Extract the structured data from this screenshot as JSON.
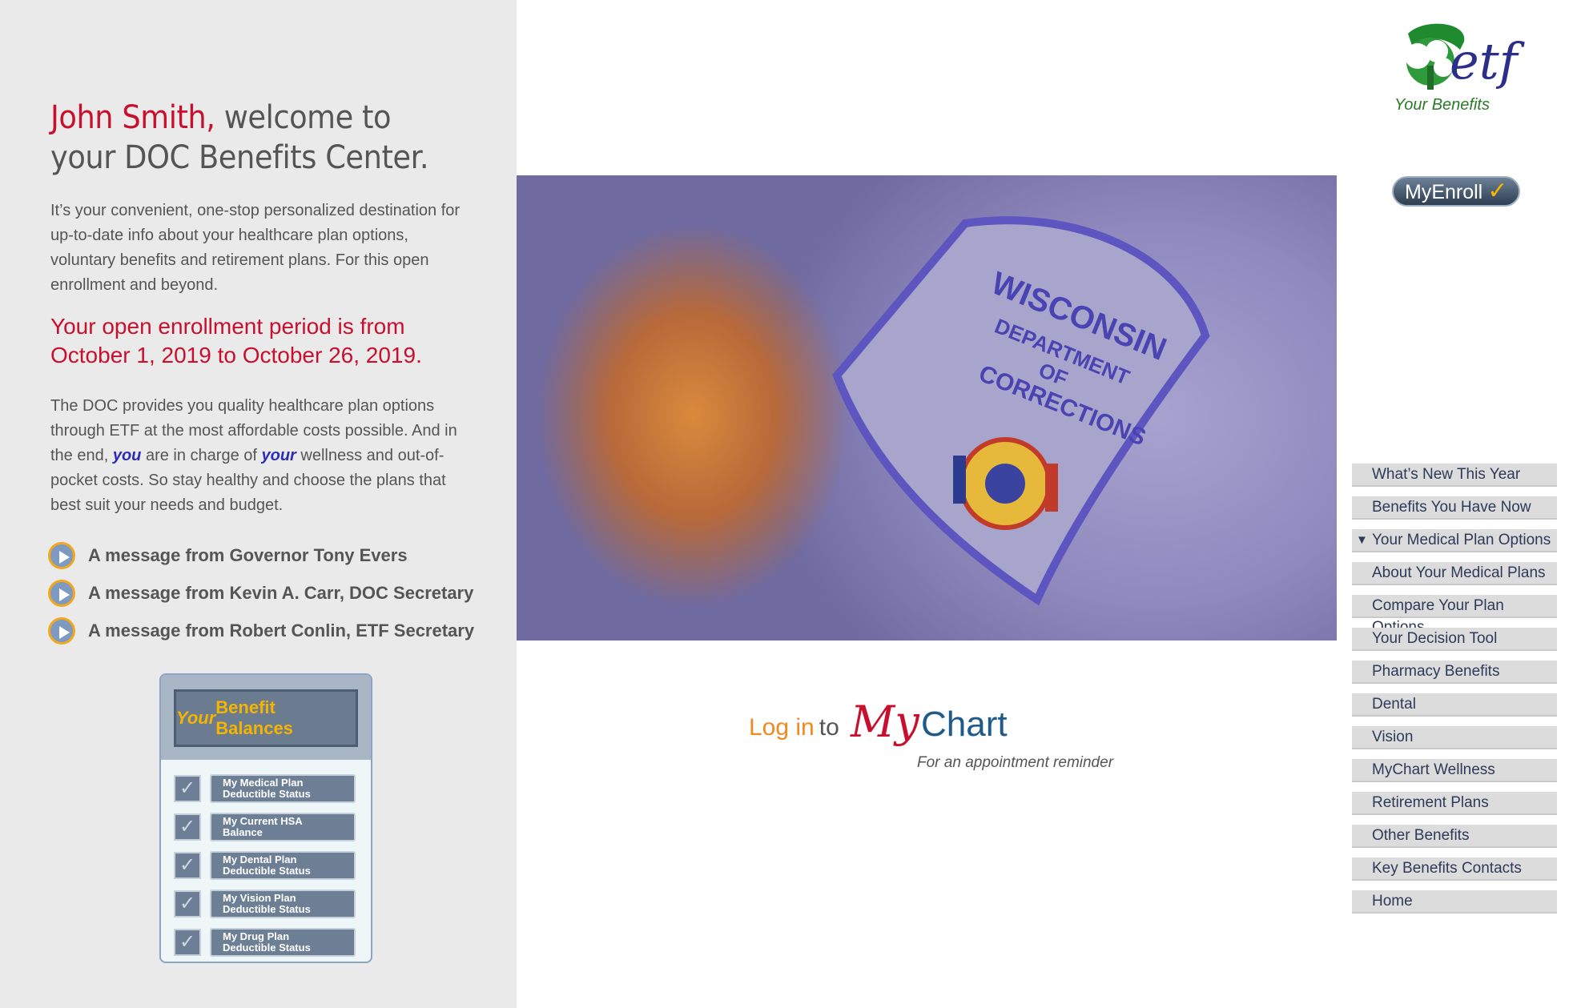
{
  "welcome": {
    "name": "John Smith,",
    "rest": " welcome to your DOC Benefits Center."
  },
  "intro": "It’s your convenient, one-stop personalized destination for up-to-date info about your healthcare plan options, voluntary benefits and retirement plans. For this open enrollment and beyond.",
  "enrollment_period": "Your open enrollment period is from October 1, 2019 to October 26, 2019.",
  "body": {
    "part1": "The DOC provides you quality healthcare plan options through ETF at the most affordable costs possible. And in the end, ",
    "you": "you",
    "part2": " are in charge of ",
    "your": "your",
    "part3": " wellness and out-of-pocket costs. So stay healthy and choose the plans that best suit your needs and budget."
  },
  "messages": [
    "A message from Governor Tony Evers",
    "A message from Kevin A. Carr, DOC Secretary",
    "A message from Robert Conlin, ETF Secretary"
  ],
  "balances": {
    "title_your": "Your",
    "title_rest": " Benefit Balances",
    "items": [
      "My Medical Plan\nDeductible Status",
      "My Current HSA\nBalance",
      "My Dental Plan\nDeductible Status",
      "My Vision Plan\nDeductible Status",
      "My Drug Plan\nDeductible Status"
    ]
  },
  "badge": {
    "line1": "WISCONSIN",
    "line2": "DEPARTMENT",
    "line3": "OF",
    "line4": "CORRECTIONS"
  },
  "mychart": {
    "login": "Log in",
    "to": "to",
    "my": "My",
    "chart": "Chart",
    "reminder": "For an appointment reminder"
  },
  "logo": {
    "etf": "etf",
    "tagline": "Your Benefits"
  },
  "myenroll": {
    "label": "MyEnroll",
    "check": "✓"
  },
  "nav": [
    {
      "label": "What’s New This Year",
      "active": false
    },
    {
      "label": "Benefits You Have Now",
      "active": false
    },
    {
      "label": "Your Medical Plan Options",
      "active": true
    },
    {
      "label": "About Your Medical Plans",
      "active": false
    },
    {
      "label": "Compare Your Plan Options",
      "active": false
    },
    {
      "label": "Your Decision Tool",
      "active": false
    },
    {
      "label": "Pharmacy Benefits",
      "active": false
    },
    {
      "label": "Dental",
      "active": false
    },
    {
      "label": "Vision",
      "active": false
    },
    {
      "label": "MyChart Wellness",
      "active": false
    },
    {
      "label": "Retirement Plans",
      "active": false
    },
    {
      "label": "Other Benefits",
      "active": false
    },
    {
      "label": "Key Benefits Contacts",
      "active": false
    },
    {
      "label": "Home",
      "active": false
    }
  ],
  "colors": {
    "accent_red": "#c8102e",
    "accent_blue": "#2b2bb8",
    "nav_text": "#2e3a59",
    "gold": "#f5b400"
  }
}
